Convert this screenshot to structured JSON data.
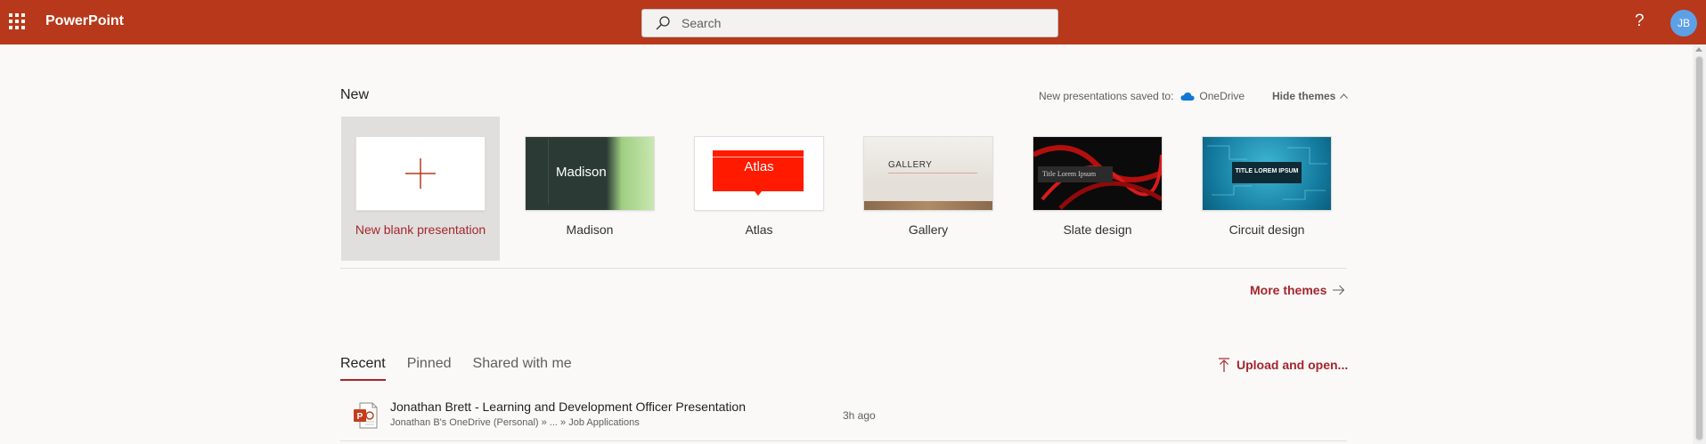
{
  "app": {
    "name": "PowerPoint",
    "bar_color": "#b7381a"
  },
  "header": {
    "search_placeholder": "Search",
    "help": "?",
    "avatar_initials": "JB"
  },
  "new_section": {
    "title": "New",
    "saved_to_label": "New presentations saved to:",
    "saved_to_location": "OneDrive",
    "hide_themes": "Hide themes",
    "templates": [
      {
        "label": "New blank presentation",
        "thumb_text": ""
      },
      {
        "label": "Madison",
        "thumb_text": "Madison"
      },
      {
        "label": "Atlas",
        "thumb_text": "Atlas"
      },
      {
        "label": "Gallery",
        "thumb_text": "GALLERY"
      },
      {
        "label": "Slate design",
        "thumb_text": "Title Lorem Ipsum"
      },
      {
        "label": "Circuit design",
        "thumb_text": "TITLE LOREM IPSUM"
      }
    ],
    "more_themes": "More themes"
  },
  "tabs": [
    {
      "label": "Recent",
      "active": true
    },
    {
      "label": "Pinned",
      "active": false
    },
    {
      "label": "Shared with me",
      "active": false
    }
  ],
  "upload_label": "Upload and open...",
  "files": [
    {
      "name": "Jonathan Brett - Learning and Development Officer Presentation",
      "path": "Jonathan B's OneDrive (Personal) » ... » Job Applications",
      "time": "3h ago",
      "icon": "powerpoint-file-icon"
    }
  ],
  "accent_color": "#a4262c"
}
